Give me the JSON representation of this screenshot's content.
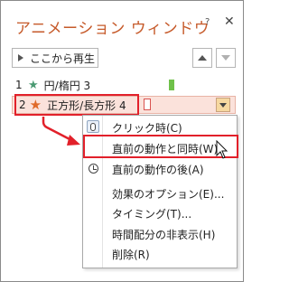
{
  "pane": {
    "title": "アニメーション ウィンドウ",
    "help_glyph": "?",
    "close_glyph": "✕"
  },
  "toolbar": {
    "play_label": "ここから再生",
    "move_up_icon": "triangle-up-icon",
    "move_down_icon": "triangle-down-icon"
  },
  "animation_list": [
    {
      "number": "1",
      "icon": "star-icon",
      "star_color": "#4a9a72",
      "label": "円/楕円 3",
      "timeline_color": "#6fc14a"
    },
    {
      "number": "2",
      "icon": "star-icon",
      "star_color": "#e06a2a",
      "label": "正方形/長方形 4",
      "timeline_color": "#d9534f",
      "selected": true
    }
  ],
  "star_glyph": "★",
  "context_menu": {
    "items": [
      {
        "label": "クリック時(C)",
        "icon": "mouse-icon"
      },
      {
        "label": "直前の動作と同時(W)",
        "highlighted": true
      },
      {
        "label": "直前の動作の後(A)",
        "icon": "clock-icon"
      },
      {
        "label": "効果のオプション(E)..."
      },
      {
        "label": "タイミング(T)..."
      },
      {
        "label": "時間配分の非表示(H)"
      },
      {
        "label": "削除(R)"
      }
    ]
  },
  "colors": {
    "title": "#c65a2a",
    "highlight_border": "#e2202a",
    "selected_row_bg": "#fbe2db",
    "menu_highlight_bg": "#fce2d6"
  }
}
